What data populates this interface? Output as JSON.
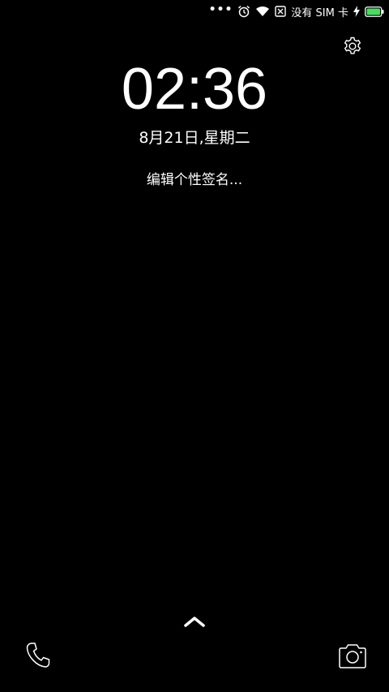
{
  "status_bar": {
    "overflow": "•••",
    "carrier": "没有 SIM 卡",
    "battery_color": "#4cd964"
  },
  "lockscreen": {
    "time": "02:36",
    "date": "8月21日,星期二",
    "signature_placeholder": "编辑个性签名..."
  },
  "icons": {
    "settings": "gear-icon",
    "swipe_up": "chevron-up-icon",
    "phone": "phone-icon",
    "camera": "camera-icon"
  }
}
